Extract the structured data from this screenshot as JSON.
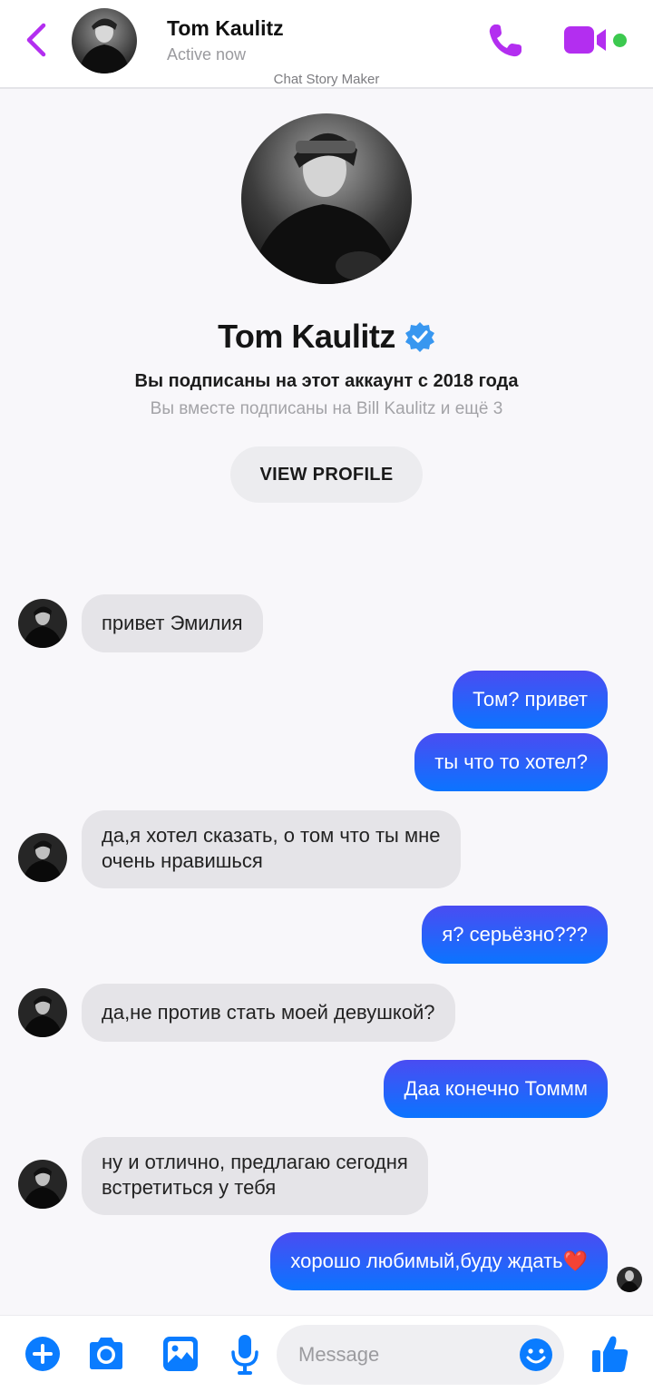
{
  "header": {
    "contact_name": "Tom Kaulitz",
    "status": "Active now",
    "watermark": "Chat Story Maker",
    "accent_color": "#b32ef0",
    "online_color": "#3cc94f"
  },
  "profile": {
    "name": "Tom Kaulitz",
    "verified": true,
    "follow_text": "Вы подписаны на этот аккаунт с 2018 года",
    "mutual_text": "Вы вместе подписаны на Bill Kaulitz и ещё 3",
    "view_profile_label": "VIEW PROFILE"
  },
  "messages": [
    {
      "from": "them",
      "text": "привет Эмилия"
    },
    {
      "from": "me",
      "text": "Том? привет"
    },
    {
      "from": "me",
      "text": "ты что то хотел?"
    },
    {
      "from": "them",
      "lines": [
        "да,я хотел сказать, о том что ты мне",
        "очень нравишься"
      ]
    },
    {
      "from": "me",
      "text": "я? серьёзно???"
    },
    {
      "from": "them",
      "text": "да,не против стать моей девушкой?"
    },
    {
      "from": "me",
      "text": "Даа конечно Томмм"
    },
    {
      "from": "them",
      "lines": [
        "ну и отлично, предлагаю сегодня",
        "встретиться у тебя"
      ]
    },
    {
      "from": "me",
      "text": "хорошо любимый,буду ждать❤️"
    }
  ],
  "composer": {
    "placeholder": "Message",
    "icons": [
      "plus-circle-icon",
      "camera-icon",
      "image-icon",
      "microphone-icon",
      "emoji-icon",
      "thumbs-up-icon"
    ],
    "icon_color": "#0a7cff"
  },
  "colors": {
    "incoming_bubble": "#e5e4e8",
    "outgoing_gradient": [
      "#4a4cf2",
      "#0b74ff"
    ]
  }
}
